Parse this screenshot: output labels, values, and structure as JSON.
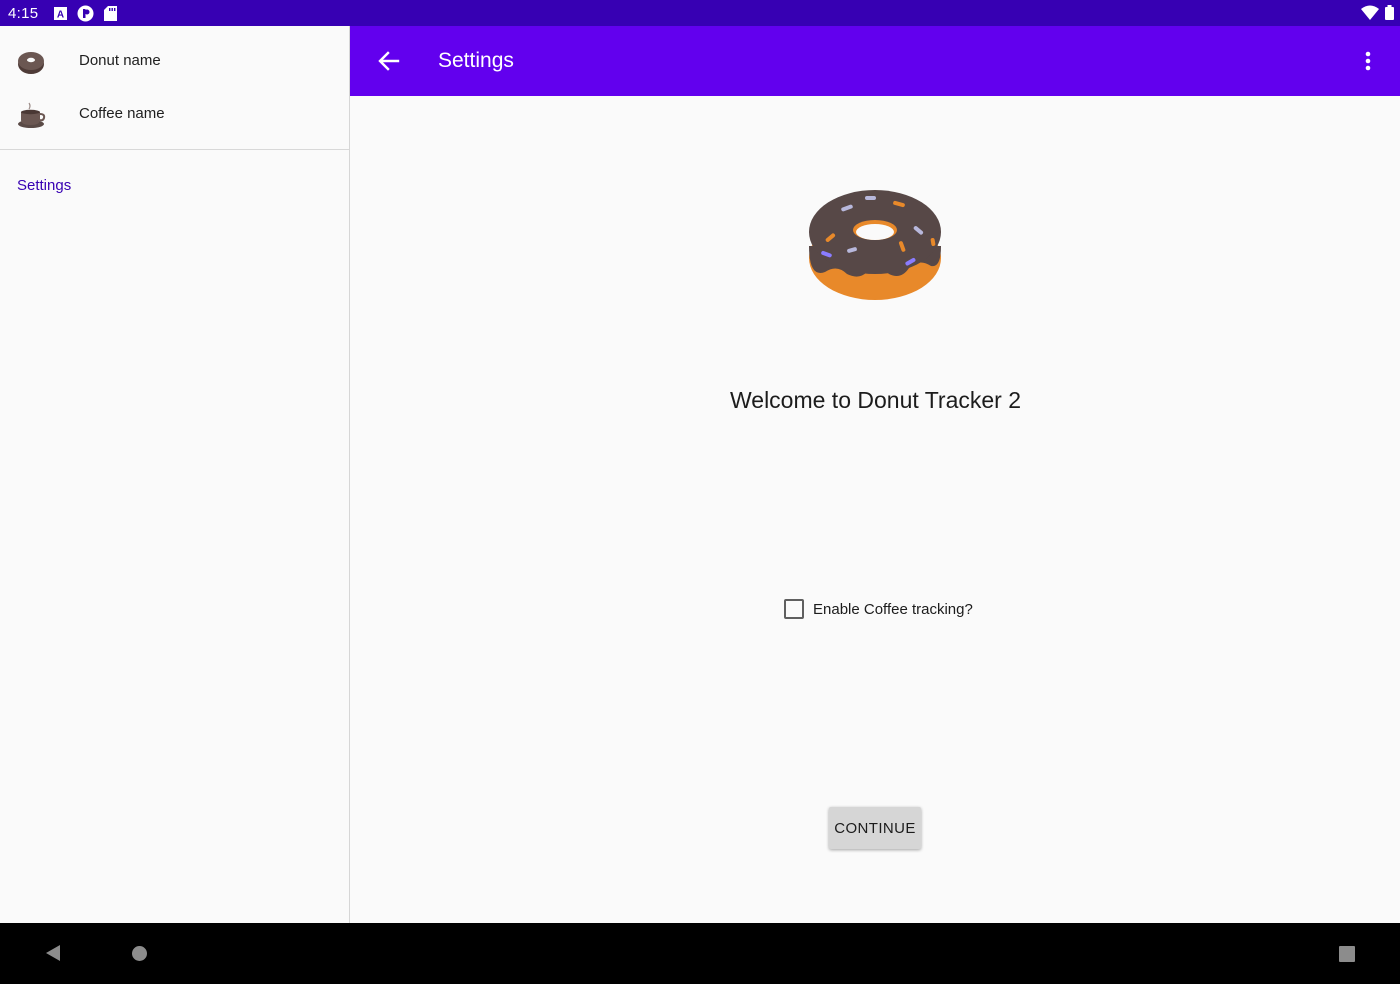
{
  "status_bar": {
    "time": "4:15",
    "left_icons": [
      "accessibility-a-icon",
      "circle-app-icon",
      "sd-card-icon"
    ],
    "right_icons": [
      "wifi-icon",
      "battery-icon"
    ]
  },
  "drawer": {
    "items": [
      {
        "label": "Donut name",
        "icon": "donut-icon"
      },
      {
        "label": "Coffee name",
        "icon": "coffee-icon"
      }
    ],
    "settings_label": "Settings"
  },
  "app_bar": {
    "title": "Settings",
    "back_icon": "arrow-back-icon",
    "overflow_icon": "more-vert-icon"
  },
  "main": {
    "image": "donut-illustration",
    "welcome_text": "Welcome to Donut Tracker 2",
    "checkbox_label": "Enable Coffee tracking?",
    "checkbox_checked": false,
    "continue_label": "CONTINUE"
  },
  "nav_bar": {
    "icons": [
      "nav-back-icon",
      "nav-home-icon",
      "nav-recents-icon"
    ]
  },
  "colors": {
    "status_bar": "#3700b3",
    "app_bar": "#6200ee",
    "accent_text": "#3700b3",
    "background": "#fafafa"
  }
}
